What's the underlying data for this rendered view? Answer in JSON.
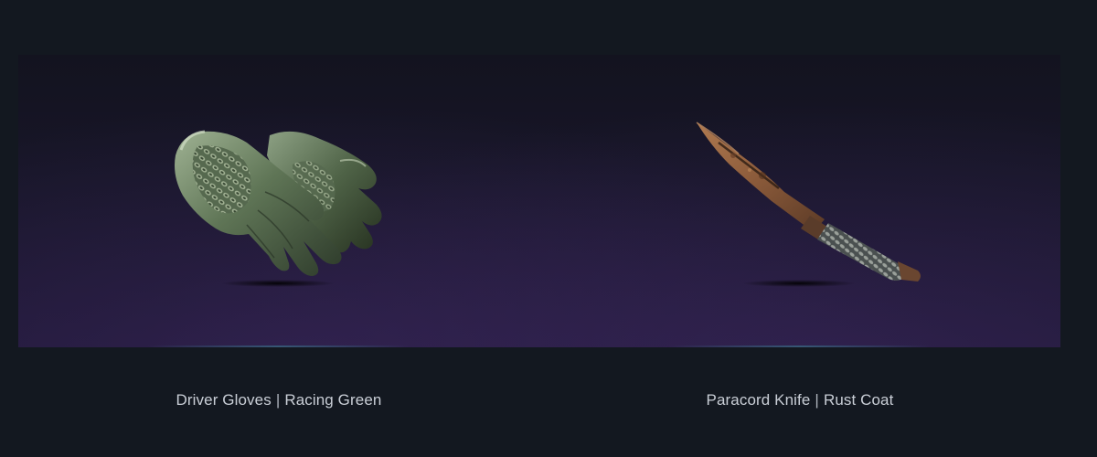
{
  "items": [
    {
      "name": "Driver Gloves",
      "separator": "|",
      "finish": "Racing Green",
      "icon": "driver-gloves-image"
    },
    {
      "name": "Paracord Knife",
      "separator": "|",
      "finish": "Rust Coat",
      "icon": "paracord-knife-image"
    }
  ],
  "colors": {
    "page_background": "#131820",
    "showcase_background": "#1a1730",
    "caption_text": "#c9ced6",
    "glove_green": "#5f7556",
    "knife_rust": "#8a5a3a"
  }
}
